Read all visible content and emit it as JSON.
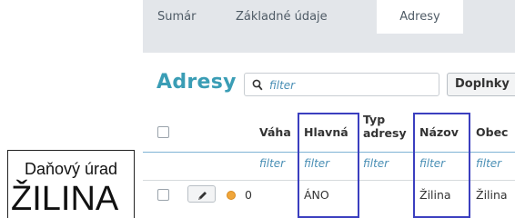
{
  "label": {
    "line1": "Daňový úrad",
    "line2": "ŽILINA"
  },
  "tabs": [
    {
      "label": "Sumár",
      "active": false
    },
    {
      "label": "Základné údaje",
      "active": false
    },
    {
      "label": "Adresy",
      "active": true
    }
  ],
  "page": {
    "title": "Adresy"
  },
  "search": {
    "placeholder": "filter",
    "icon": "search-icon"
  },
  "extra_button": "Doplnky",
  "table": {
    "headers": {
      "weight": "Váha",
      "main": "Hlavná",
      "type_line1": "Typ",
      "type_line2": "adresy",
      "name": "Názov",
      "city": "Obec"
    },
    "filter_text": "filter",
    "rows": [
      {
        "status_color": "#f0a63a",
        "weight": "0",
        "main": "ÁNO",
        "name": "Žilina",
        "city": "Žilina"
      }
    ]
  },
  "colors": {
    "accent": "#3a9db5",
    "highlight": "#3b3fbf",
    "filter": "#4a8fb5"
  }
}
